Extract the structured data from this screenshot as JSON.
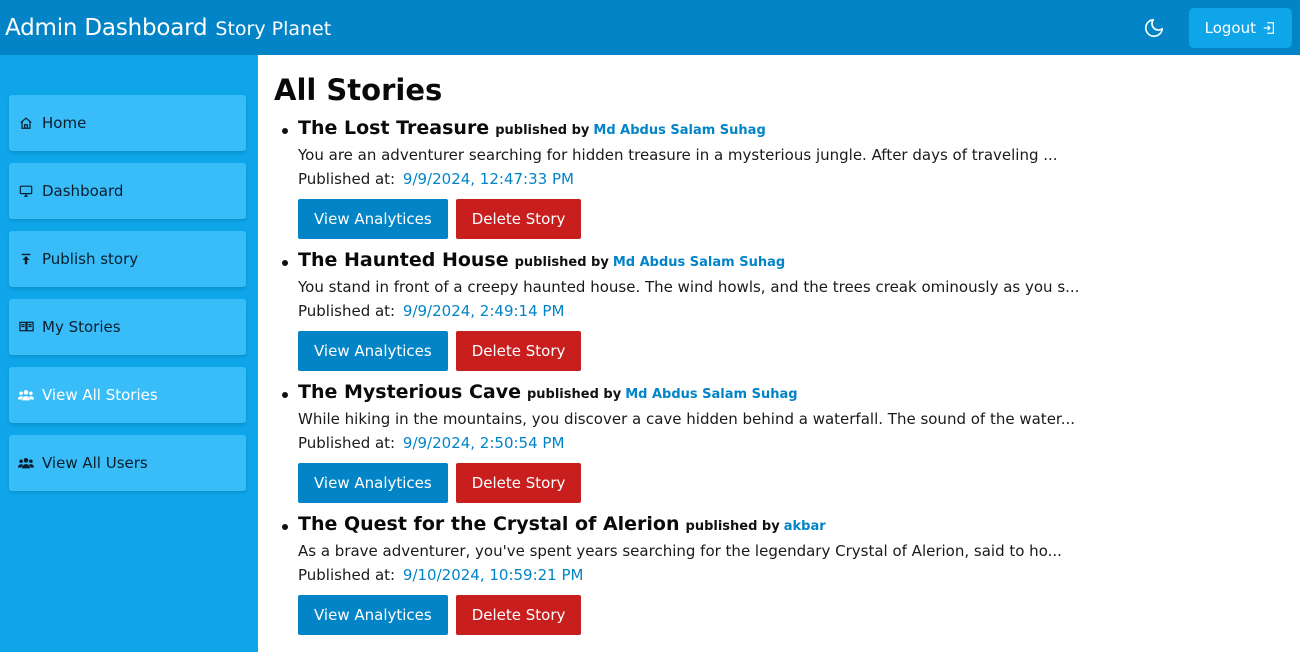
{
  "header": {
    "title": "Admin Dashboard",
    "subtitle": "Story Planet",
    "logout_label": "Logout"
  },
  "sidebar": {
    "items": [
      {
        "label": "Home",
        "icon": "home-icon"
      },
      {
        "label": "Dashboard",
        "icon": "monitor-icon"
      },
      {
        "label": "Publish story",
        "icon": "upload-icon"
      },
      {
        "label": "My Stories",
        "icon": "book-icon"
      },
      {
        "label": "View All Stories",
        "icon": "users-icon",
        "active": true
      },
      {
        "label": "View All Users",
        "icon": "users-icon"
      }
    ]
  },
  "main": {
    "title": "All Stories",
    "published_by_label": "published by",
    "published_at_label": "Published at:",
    "view_analytics_label": "View Analytices",
    "delete_label": "Delete Story",
    "stories": [
      {
        "title": "The Lost Treasure",
        "author": "Md Abdus Salam Suhag",
        "excerpt": "You are an adventurer searching for hidden treasure in a mysterious jungle. After days of traveling ...",
        "published_at": "9/9/2024, 12:47:33 PM"
      },
      {
        "title": "The Haunted House",
        "author": "Md Abdus Salam Suhag",
        "excerpt": "You stand in front of a creepy haunted house. The wind howls, and the trees creak ominously as you s...",
        "published_at": "9/9/2024, 2:49:14 PM"
      },
      {
        "title": "The Mysterious Cave",
        "author": "Md Abdus Salam Suhag",
        "excerpt": "While hiking in the mountains, you discover a cave hidden behind a waterfall. The sound of the water...",
        "published_at": "9/9/2024, 2:50:54 PM"
      },
      {
        "title": "The Quest for the Crystal of Alerion",
        "author": "akbar",
        "excerpt": "As a brave adventurer, you've spent years searching for the legendary Crystal of Alerion, said to ho...",
        "published_at": "9/10/2024, 10:59:21 PM"
      }
    ]
  },
  "colors": {
    "header_bg": "#0284c7",
    "sidebar_bg": "#0ea5e9",
    "sidebar_item_bg": "#38bdf8",
    "accent": "#0284c7",
    "danger": "#c81e1e"
  }
}
